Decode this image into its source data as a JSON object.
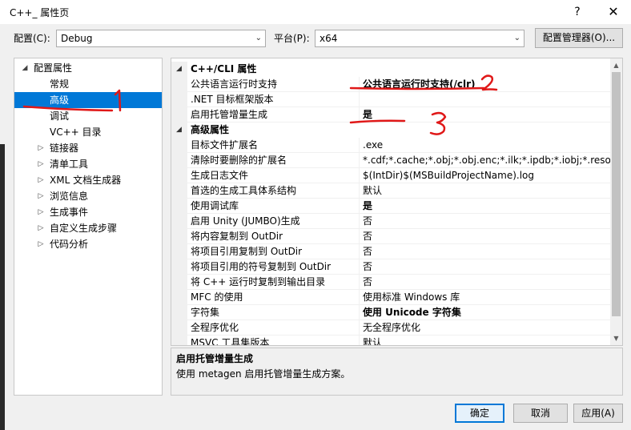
{
  "window": {
    "title": "C++_ 属性页",
    "help_glyph": "?",
    "close_glyph": "✕"
  },
  "config": {
    "config_label": "配置(C):",
    "config_value": "Debug",
    "platform_label": "平台(P):",
    "platform_value": "x64",
    "manager_button": "配置管理器(O)..."
  },
  "tree": {
    "items": [
      {
        "label": "配置属性",
        "expander": "◢",
        "level": 0
      },
      {
        "label": "常规",
        "expander": "",
        "level": 1
      },
      {
        "label": "高级",
        "expander": "",
        "level": 1,
        "selected": true
      },
      {
        "label": "调试",
        "expander": "",
        "level": 1
      },
      {
        "label": "VC++ 目录",
        "expander": "",
        "level": 1
      },
      {
        "label": "链接器",
        "expander": "▷",
        "level": 1
      },
      {
        "label": "清单工具",
        "expander": "▷",
        "level": 1
      },
      {
        "label": "XML 文档生成器",
        "expander": "▷",
        "level": 1
      },
      {
        "label": "浏览信息",
        "expander": "▷",
        "level": 1
      },
      {
        "label": "生成事件",
        "expander": "▷",
        "level": 1
      },
      {
        "label": "自定义生成步骤",
        "expander": "▷",
        "level": 1
      },
      {
        "label": "代码分析",
        "expander": "▷",
        "level": 1
      }
    ]
  },
  "grid": {
    "rows": [
      {
        "type": "category",
        "name": "C++/CLI 属性",
        "expander": "◢"
      },
      {
        "type": "prop",
        "name": "公共语言运行时支持",
        "value": "公共语言运行时支持(/clr)",
        "bold": true
      },
      {
        "type": "prop",
        "name": ".NET 目标框架版本",
        "value": ""
      },
      {
        "type": "prop",
        "name": "启用托管增量生成",
        "value": "是",
        "bold": true
      },
      {
        "type": "category",
        "name": "高级属性",
        "expander": "◢"
      },
      {
        "type": "prop",
        "name": "目标文件扩展名",
        "value": ".exe"
      },
      {
        "type": "prop",
        "name": "清除时要删除的扩展名",
        "value": "*.cdf;*.cache;*.obj;*.obj.enc;*.ilk;*.ipdb;*.iobj;*.resources"
      },
      {
        "type": "prop",
        "name": "生成日志文件",
        "value": "$(IntDir)$(MSBuildProjectName).log"
      },
      {
        "type": "prop",
        "name": "首选的生成工具体系结构",
        "value": "默认"
      },
      {
        "type": "prop",
        "name": "使用调试库",
        "value": "是",
        "bold": true
      },
      {
        "type": "prop",
        "name": "启用 Unity (JUMBO)生成",
        "value": "否"
      },
      {
        "type": "prop",
        "name": "将内容复制到 OutDir",
        "value": "否"
      },
      {
        "type": "prop",
        "name": "将项目引用复制到 OutDir",
        "value": "否"
      },
      {
        "type": "prop",
        "name": "将项目引用的符号复制到 OutDir",
        "value": "否"
      },
      {
        "type": "prop",
        "name": "将 C++ 运行时复制到输出目录",
        "value": "否"
      },
      {
        "type": "prop",
        "name": "MFC 的使用",
        "value": "使用标准 Windows 库"
      },
      {
        "type": "prop",
        "name": "字符集",
        "value": "使用 Unicode 字符集",
        "bold": true
      },
      {
        "type": "prop",
        "name": "全程序优化",
        "value": "无全程序优化"
      },
      {
        "type": "prop",
        "name": "MSVC 工具集版本",
        "value": "默认"
      }
    ]
  },
  "description": {
    "title": "启用托管增量生成",
    "text": "使用 metagen 启用托管增量生成方案。"
  },
  "footer": {
    "ok": "确定",
    "cancel": "取消",
    "apply": "应用(A)"
  },
  "colors": {
    "selection": "#0078d7",
    "annotation": "#e01818"
  }
}
